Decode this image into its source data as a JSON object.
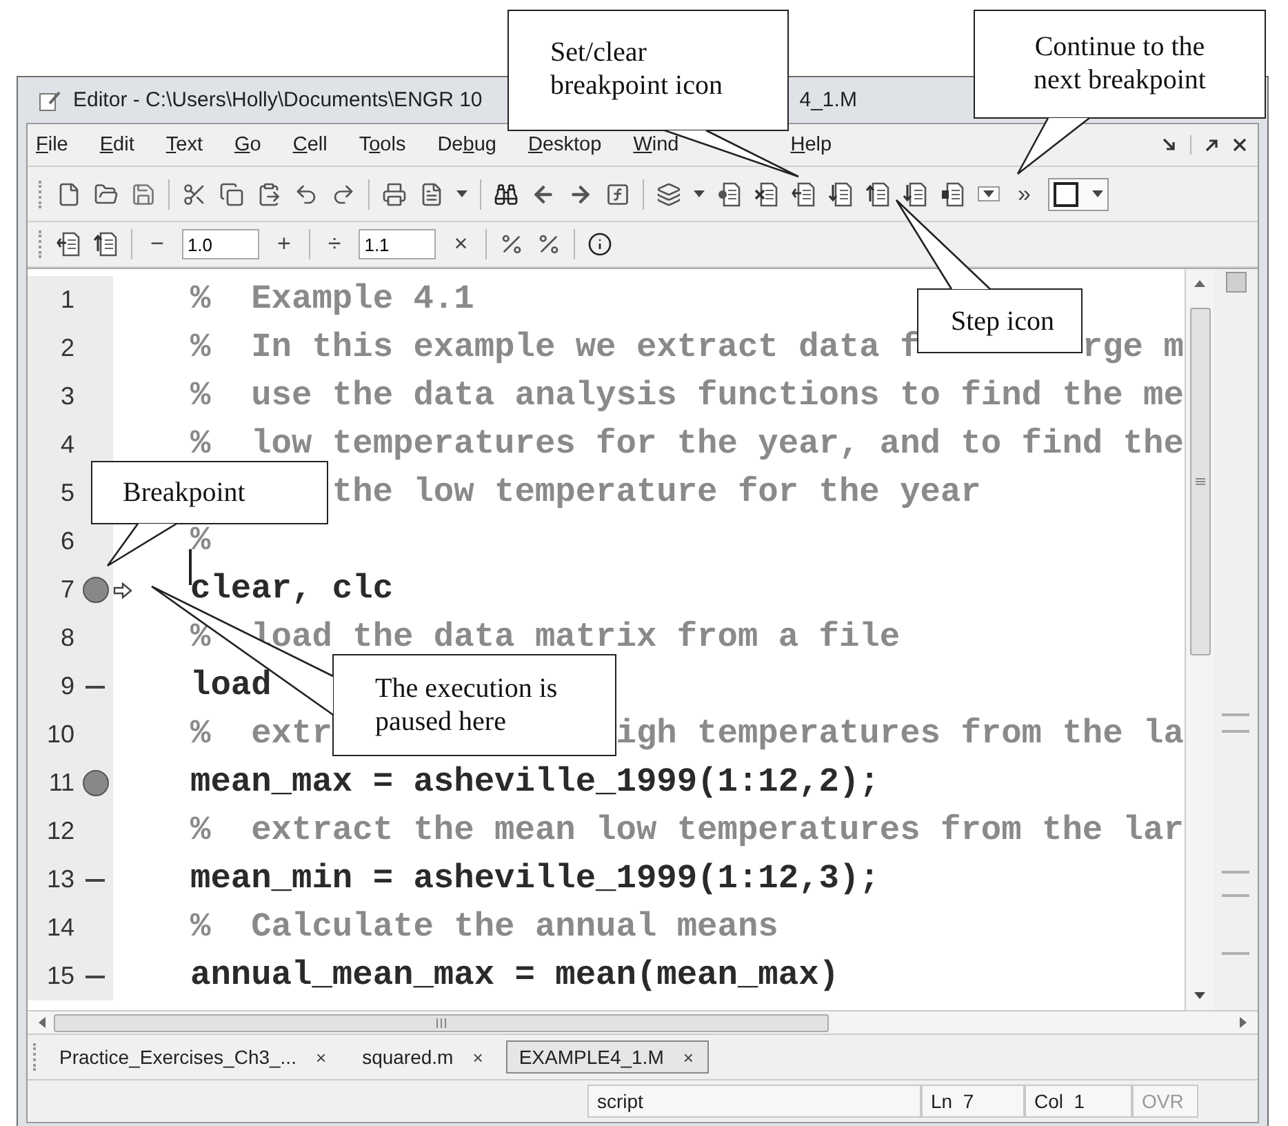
{
  "window": {
    "title": [
      "Editor - C:\\Users\\Holly\\Documents\\ENGR 10",
      "4_1.M"
    ]
  },
  "menu": [
    {
      "key": "F",
      "after": "ile"
    },
    {
      "key": "E",
      "after": "dit"
    },
    {
      "key": "T",
      "after": "ext"
    },
    {
      "key": "G",
      "after": "o"
    },
    {
      "key": "C",
      "after": "ell"
    },
    {
      "before": "T",
      "key": "o",
      "after": "ols"
    },
    {
      "before": "De",
      "key": "b",
      "after": "ug"
    },
    {
      "key": "D",
      "after": "esktop"
    },
    {
      "key": "W",
      "after": "ind"
    },
    {
      "key": "H",
      "after": "elp"
    }
  ],
  "toolbar": {
    "overflow": "»"
  },
  "cell_toolbar": {
    "minus": "−",
    "first_value": "1.0",
    "plus": "+",
    "divide": "÷",
    "second_value": "1.1",
    "times": "×"
  },
  "lines": [
    {
      "number": "1",
      "kind": "comment",
      "breakpoint": false,
      "executable_marker": false,
      "current": false,
      "segments": [
        "%  Example 4.1"
      ]
    },
    {
      "number": "2",
      "kind": "comment",
      "breakpoint": false,
      "executable_marker": false,
      "current": false,
      "segments": [
        "%  In this example we extract data f",
        "rge m"
      ]
    },
    {
      "number": "3",
      "kind": "comment",
      "breakpoint": false,
      "executable_marker": false,
      "current": false,
      "segments": [
        "%  use the data analysis functions to find the me"
      ]
    },
    {
      "number": "4",
      "kind": "comment",
      "breakpoint": false,
      "executable_marker": false,
      "current": false,
      "segments": [
        "%  low temperatures for the year, and to find the"
      ]
    },
    {
      "number": "5",
      "kind": "comment",
      "breakpoint": false,
      "executable_marker": false,
      "current": false,
      "segments": [
        "the low temperature for the year"
      ]
    },
    {
      "number": "6",
      "kind": "comment",
      "breakpoint": false,
      "executable_marker": false,
      "current": false,
      "segments": [
        "%"
      ]
    },
    {
      "number": "7",
      "kind": "code",
      "breakpoint": true,
      "executable_marker": false,
      "current": true,
      "segments": [
        "clear, clc"
      ]
    },
    {
      "number": "8",
      "kind": "comment",
      "breakpoint": false,
      "executable_marker": false,
      "current": false,
      "segments": [
        "%  load the data matrix from a file"
      ]
    },
    {
      "number": "9",
      "kind": "code",
      "breakpoint": false,
      "executable_marker": true,
      "current": false,
      "segments": [
        "load"
      ]
    },
    {
      "number": "10",
      "kind": "comment",
      "breakpoint": false,
      "executable_marker": false,
      "current": false,
      "segments": [
        "%  extr",
        "igh temperatures from the la"
      ]
    },
    {
      "number": "11",
      "kind": "code",
      "breakpoint": true,
      "executable_marker": false,
      "current": false,
      "segments": [
        "mean_max = asheville_1999(1:12,2);"
      ]
    },
    {
      "number": "12",
      "kind": "comment",
      "breakpoint": false,
      "executable_marker": false,
      "current": false,
      "segments": [
        "%  extract the mean low temperatures from the lar"
      ]
    },
    {
      "number": "13",
      "kind": "code",
      "breakpoint": false,
      "executable_marker": true,
      "current": false,
      "segments": [
        "mean_min = asheville_1999(1:12,3);"
      ]
    },
    {
      "number": "14",
      "kind": "comment",
      "breakpoint": false,
      "executable_marker": false,
      "current": false,
      "segments": [
        "%  Calculate the annual means"
      ]
    },
    {
      "number": "15",
      "kind": "code",
      "breakpoint": false,
      "executable_marker": true,
      "current": false,
      "segments": [
        "annual_mean_max = mean(mean_max)"
      ]
    }
  ],
  "tabs": [
    {
      "label": "Practice_Exercises_Ch3_...",
      "close": "×",
      "selected": false
    },
    {
      "label": "squared.m",
      "close": "×",
      "selected": false
    },
    {
      "label": "EXAMPLE4_1.M",
      "close": "×",
      "selected": true
    }
  ],
  "status_bar": {
    "mode": "script",
    "line": "Ln  7",
    "column": "Col  1",
    "overwrite": "OVR"
  },
  "callouts": [
    {
      "text": "Set/clear breakpoint icon"
    },
    {
      "text": "Continue to the next breakpoint"
    },
    {
      "text": "Step icon"
    },
    {
      "text": "Breakpoint"
    },
    {
      "text": "The execution is paused here"
    }
  ]
}
